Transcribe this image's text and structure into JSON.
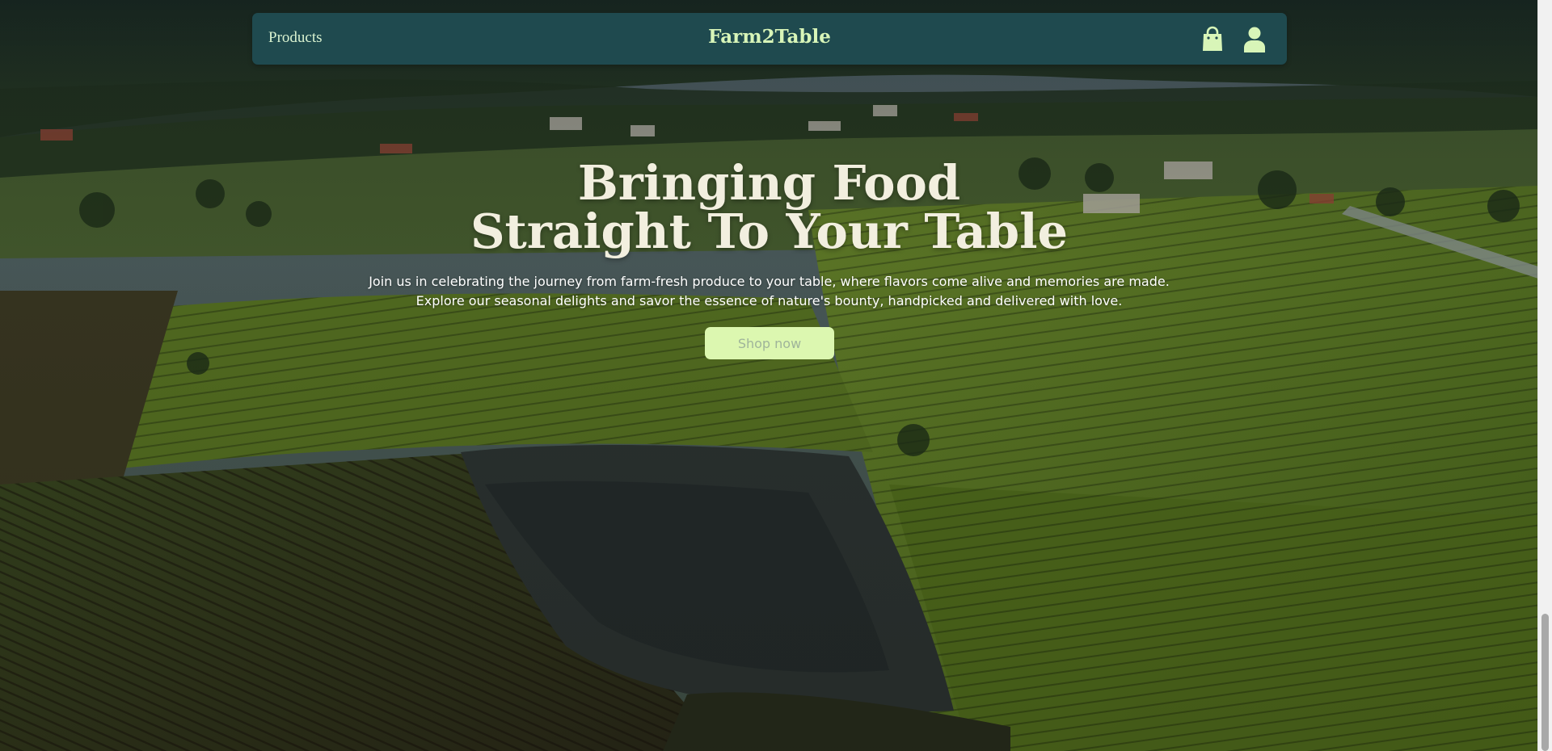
{
  "navbar": {
    "products_label": "Products",
    "brand": "Farm2Table",
    "cart_icon": "shopping-bag-icon",
    "account_icon": "user-icon"
  },
  "hero": {
    "title_line1": "Bringing Food",
    "title_line2": "Straight To Your Table",
    "subtitle_line1": "Join us in celebrating the journey from farm-fresh produce to your table, where flavors come alive and memories are made.",
    "subtitle_line2": "Explore our seasonal delights and savor the essence of nature's bounty, handpicked and delivered with love.",
    "cta_label": "Shop now"
  },
  "colors": {
    "navbar_bg": "#1f4a4f",
    "brand_text": "#d8f5b8",
    "cta_bg": "#dcf7b0",
    "cta_text": "#9fb49a",
    "title_text": "#f2efdf"
  }
}
